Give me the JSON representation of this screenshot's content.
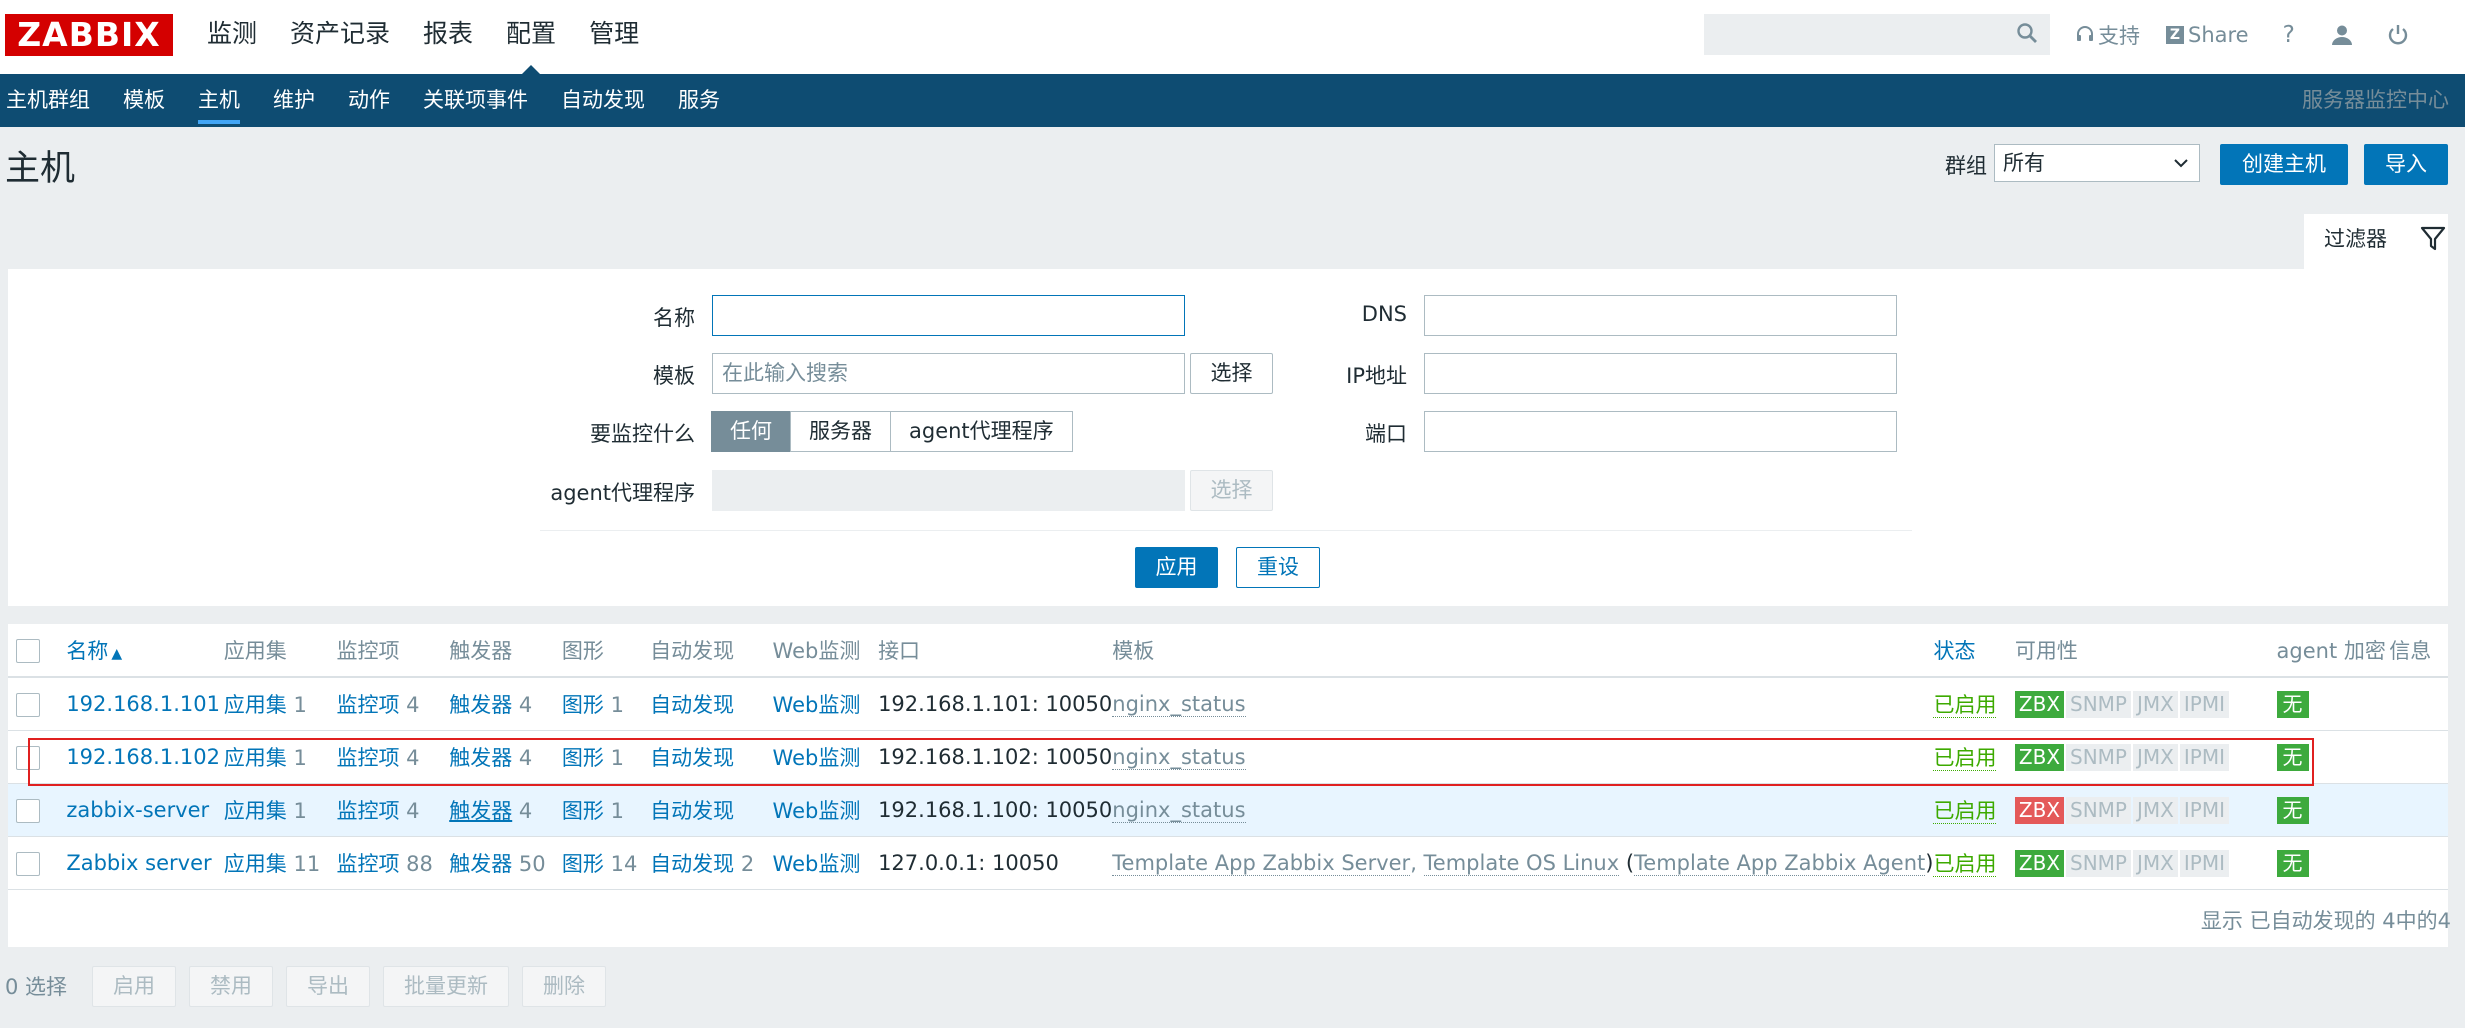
{
  "logo": "ZABBIX",
  "main_menu": [
    "监测",
    "资产记录",
    "报表",
    "配置",
    "管理"
  ],
  "tools": {
    "support": "支持",
    "share": "Share",
    "help": "?"
  },
  "sub_menu": [
    "主机群组",
    "模板",
    "主机",
    "维护",
    "动作",
    "关联项事件",
    "自动发现",
    "服务"
  ],
  "server_name": "服务器监控中心",
  "page_title": "主机",
  "group": {
    "label": "群组",
    "value": "所有"
  },
  "buttons": {
    "create_host": "创建主机",
    "import": "导入"
  },
  "filter": {
    "tab_label": "过滤器",
    "name_label": "名称",
    "name_value": "",
    "template_label": "模板",
    "template_placeholder": "在此输入搜索",
    "select_label": "选择",
    "monitored_by_label": "要监控什么",
    "monitored_by_options": [
      "任何",
      "服务器",
      "agent代理程序"
    ],
    "proxy_label": "agent代理程序",
    "dns_label": "DNS",
    "ip_label": "IP地址",
    "port_label": "端口",
    "apply": "应用",
    "reset": "重设"
  },
  "table": {
    "headers": {
      "name": "名称",
      "applications": "应用集",
      "items": "监控项",
      "triggers": "触发器",
      "graphs": "图形",
      "discovery": "自动发现",
      "web": "Web监测",
      "interface": "接口",
      "templates": "模板",
      "status": "状态",
      "availability": "可用性",
      "encryption": "agent 加密",
      "info": "信息"
    },
    "rows": [
      {
        "name": "192.168.1.101",
        "app": "应用集",
        "app_n": "1",
        "items": "监控项",
        "items_n": "4",
        "trig": "触发器",
        "trig_n": "4",
        "graphs": "图形",
        "graphs_n": "1",
        "disc": "自动发现",
        "disc_n": "",
        "web": "Web监测",
        "iface": "192.168.1.101: 10050",
        "templates": "nginx_status",
        "status": "已启用",
        "zbx": "ZBX",
        "snmp": "SNMP",
        "jmx": "JMX",
        "ipmi": "IPMI",
        "enc": "无"
      },
      {
        "name": "192.168.1.102",
        "app": "应用集",
        "app_n": "1",
        "items": "监控项",
        "items_n": "4",
        "trig": "触发器",
        "trig_n": "4",
        "graphs": "图形",
        "graphs_n": "1",
        "disc": "自动发现",
        "disc_n": "",
        "web": "Web监测",
        "iface": "192.168.1.102: 10050",
        "templates": "nginx_status",
        "status": "已启用",
        "zbx": "ZBX",
        "snmp": "SNMP",
        "jmx": "JMX",
        "ipmi": "IPMI",
        "enc": "无"
      },
      {
        "name": "zabbix-server",
        "app": "应用集",
        "app_n": "1",
        "items": "监控项",
        "items_n": "4",
        "trig": "触发器",
        "trig_n": "4",
        "graphs": "图形",
        "graphs_n": "1",
        "disc": "自动发现",
        "disc_n": "",
        "web": "Web监测",
        "iface": "192.168.1.100: 10050",
        "templates": "nginx_status",
        "status": "已启用",
        "zbx": "ZBX",
        "snmp": "SNMP",
        "jmx": "JMX",
        "ipmi": "IPMI",
        "enc": "无"
      },
      {
        "name": "Zabbix server",
        "app": "应用集",
        "app_n": "11",
        "items": "监控项",
        "items_n": "88",
        "trig": "触发器",
        "trig_n": "50",
        "graphs": "图形",
        "graphs_n": "14",
        "disc": "自动发现",
        "disc_n": "2",
        "web": "Web监测",
        "iface": "127.0.0.1: 10050",
        "tpl1": "Template App Zabbix Server",
        "tpl2": "Template OS Linux",
        "tpl3": "Template App Zabbix Agent",
        "status": "已启用",
        "zbx": "ZBX",
        "snmp": "SNMP",
        "jmx": "JMX",
        "ipmi": "IPMI",
        "enc": "无"
      }
    ],
    "footer": "显示 已自动发现的 4中的4"
  },
  "bottom": {
    "selected": "0 选择",
    "actions": [
      "启用",
      "禁用",
      "导出",
      "批量更新",
      "删除"
    ]
  },
  "colors": {
    "brand": "#d40000",
    "nav": "#0e4c72",
    "link": "#0275b8",
    "enabled": "#3daa00",
    "zbx_ok": "#3daa3d",
    "zbx_error": "#e45959"
  }
}
